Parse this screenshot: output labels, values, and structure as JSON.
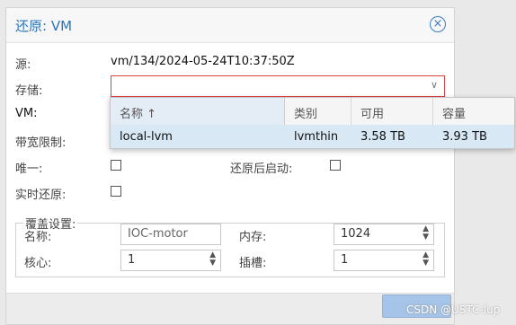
{
  "dialog": {
    "title": "还原: VM",
    "source_label": "源:",
    "source_value": "vm/134/2024-05-24T10:37:50Z",
    "storage_label": "存储:",
    "storage_value": "",
    "vm_label": "VM:",
    "bandwidth_label": "带宽限制:",
    "unique_label": "唯一:",
    "start_after_restore_label": "还原后启动:",
    "live_restore_label": "实时还原:"
  },
  "override": {
    "legend": "覆盖设置:",
    "name_label": "名称:",
    "name_placeholder": "IOC-motor",
    "memory_label": "内存:",
    "memory_value": "1024",
    "cores_label": "核心:",
    "cores_value": "1",
    "sockets_label": "插槽:",
    "sockets_value": "1"
  },
  "storage_dropdown": {
    "columns": [
      "名称 ↑",
      "类别",
      "可用",
      "容量"
    ],
    "rows": [
      {
        "name": "local-lvm",
        "type": "lvmthin",
        "avail": "3.58 TB",
        "capacity": "3.93 TB"
      }
    ]
  },
  "watermark": "CSDN @USTC-lup",
  "icons": {
    "close": "close-icon",
    "dropdown_trigger": "chevron-down-icon",
    "spinner": "spinner-arrows-icon"
  },
  "colors": {
    "title": "#2e74b7",
    "invalid_border": "#dd4444",
    "selected_row": "#d9e8f5"
  }
}
